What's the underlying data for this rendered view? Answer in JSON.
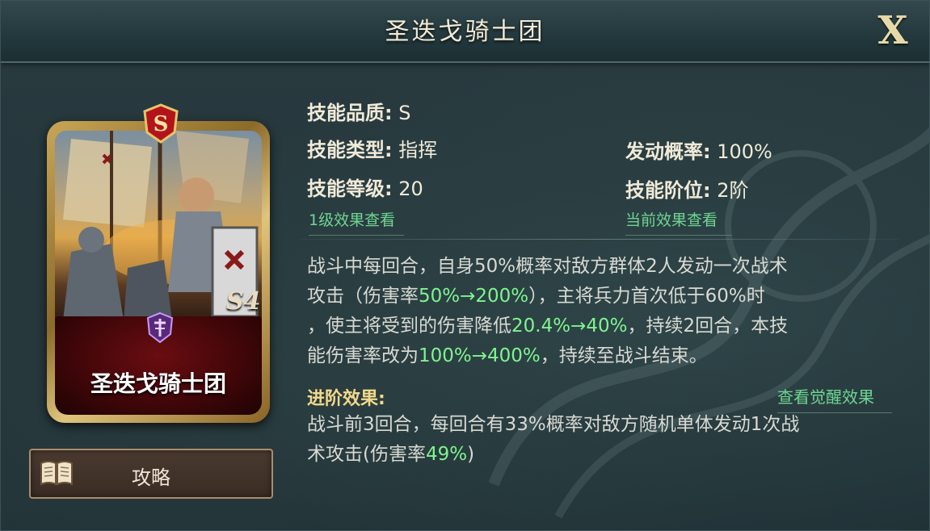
{
  "header": {
    "title": "圣迭戈骑士团",
    "close_label": "X"
  },
  "card": {
    "grade": "S",
    "name": "圣迭戈骑士团",
    "level_mark": "S4"
  },
  "guide_button": {
    "label": "攻略"
  },
  "skill_info": {
    "quality_label": "技能品质:",
    "quality_value": "S",
    "type_label": "技能类型:",
    "type_value": "指挥",
    "level_label": "技能等级:",
    "level_value": "20",
    "rate_label": "发动概率:",
    "rate_value": "100%",
    "tier_label": "技能阶位:",
    "tier_value": "2阶"
  },
  "links": {
    "level1_effect": "1级效果查看",
    "current_effect": "当前效果查看",
    "awaken_effect": "查看觉醒效果"
  },
  "description": {
    "line1": "战斗中每回合，自身50%概率对敌方群体2人发动一次战术",
    "line2_a": "攻击（伤害率",
    "line2_hl": "50%→200%",
    "line2_b": "），主将兵力首次低于60%时",
    "line3_a": "，使主将受到的伤害降低",
    "line3_hl": "20.4%→40%",
    "line3_b": "，持续2回合，本技",
    "line4_a": "能伤害率改为",
    "line4_hl": "100%→400%",
    "line4_b": "，持续至战斗结束。"
  },
  "advanced": {
    "title": "进阶效果:",
    "line1": "战斗前3回合，每回合有33%概率对敌方随机单体发动1次战",
    "line2_a": "术攻击(伤害率",
    "line2_hl": "49%",
    "line2_b": ")"
  },
  "colors": {
    "highlight": "#7ff58f",
    "link": "#6fd691",
    "section_title": "#f3d98a",
    "text": "#d8d9d2"
  }
}
